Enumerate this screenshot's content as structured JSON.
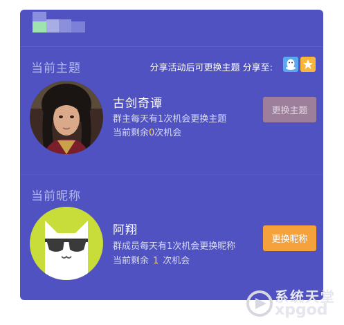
{
  "colors": {
    "panel_bg": "#4f52c0",
    "section_title": "#b5b8ee",
    "highlight_count": "#ffd65a",
    "disabled_button": "#9d7f9c",
    "active_button": "#f6a23c",
    "qq_button": "#5aa7f2",
    "qzone_button": "#f7b53b"
  },
  "header": {
    "logo_icon": "pixelated-logo-icon"
  },
  "theme": {
    "section_title": "当前主题",
    "share_note": "分享活动后可更换主题  分享至:",
    "share_buttons": [
      {
        "icon": "qq-penguin-icon"
      },
      {
        "icon": "qzone-star-icon"
      }
    ],
    "name": "古剑奇谭",
    "rule": "群主每天有1次机会更换主题",
    "remaining_prefix": "当前剩余",
    "remaining_count": "0",
    "remaining_suffix": "次机会",
    "button_label": "更换主题"
  },
  "nickname": {
    "section_title": "当前昵称",
    "name": "阿翔",
    "rule": "群成员每天有1次机会更换昵称",
    "remaining_prefix": "当前剩余",
    "remaining_count": "1",
    "remaining_suffix": "次机会",
    "button_label": "更换昵称"
  },
  "watermark": {
    "text_cn": "系统天堂",
    "text_en": "xpgod"
  }
}
